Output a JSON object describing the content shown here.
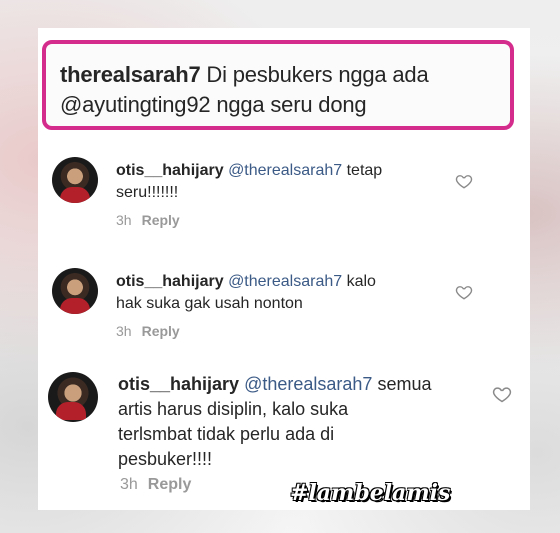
{
  "caption": {
    "username": "therealsarah7",
    "text_line1": " Di pesbukers ngga ada",
    "text_line2": "@ayutingting92 ngga seru dong"
  },
  "comments": [
    {
      "username": "otis__hahijary",
      "mention": "@therealsarah7",
      "text_line1": " tetap",
      "text_line2": "seru!!!!!!!",
      "text_line3": "",
      "text_line4": "",
      "time": "3h",
      "reply_label": "Reply"
    },
    {
      "username": "otis__hahijary",
      "mention": "@therealsarah7",
      "text_line1": " kalo",
      "text_line2": "hak suka gak usah nonton",
      "text_line3": "",
      "text_line4": "",
      "time": "3h",
      "reply_label": "Reply"
    },
    {
      "username": "otis__hahijary",
      "mention": "@therealsarah7",
      "text_line1": " semua",
      "text_line2": "artis harus disiplin, kalo suka",
      "text_line3": "terlsmbat tidak perlu ada di",
      "text_line4": "pesbuker!!!!",
      "time": "3h",
      "reply_label": "Reply"
    }
  ],
  "watermark": "#lambelamis",
  "colors": {
    "highlight_border": "#d42c8c",
    "mention": "#3b5a86",
    "meta": "#999999"
  },
  "icons": [
    "heart-icon",
    "avatar"
  ]
}
